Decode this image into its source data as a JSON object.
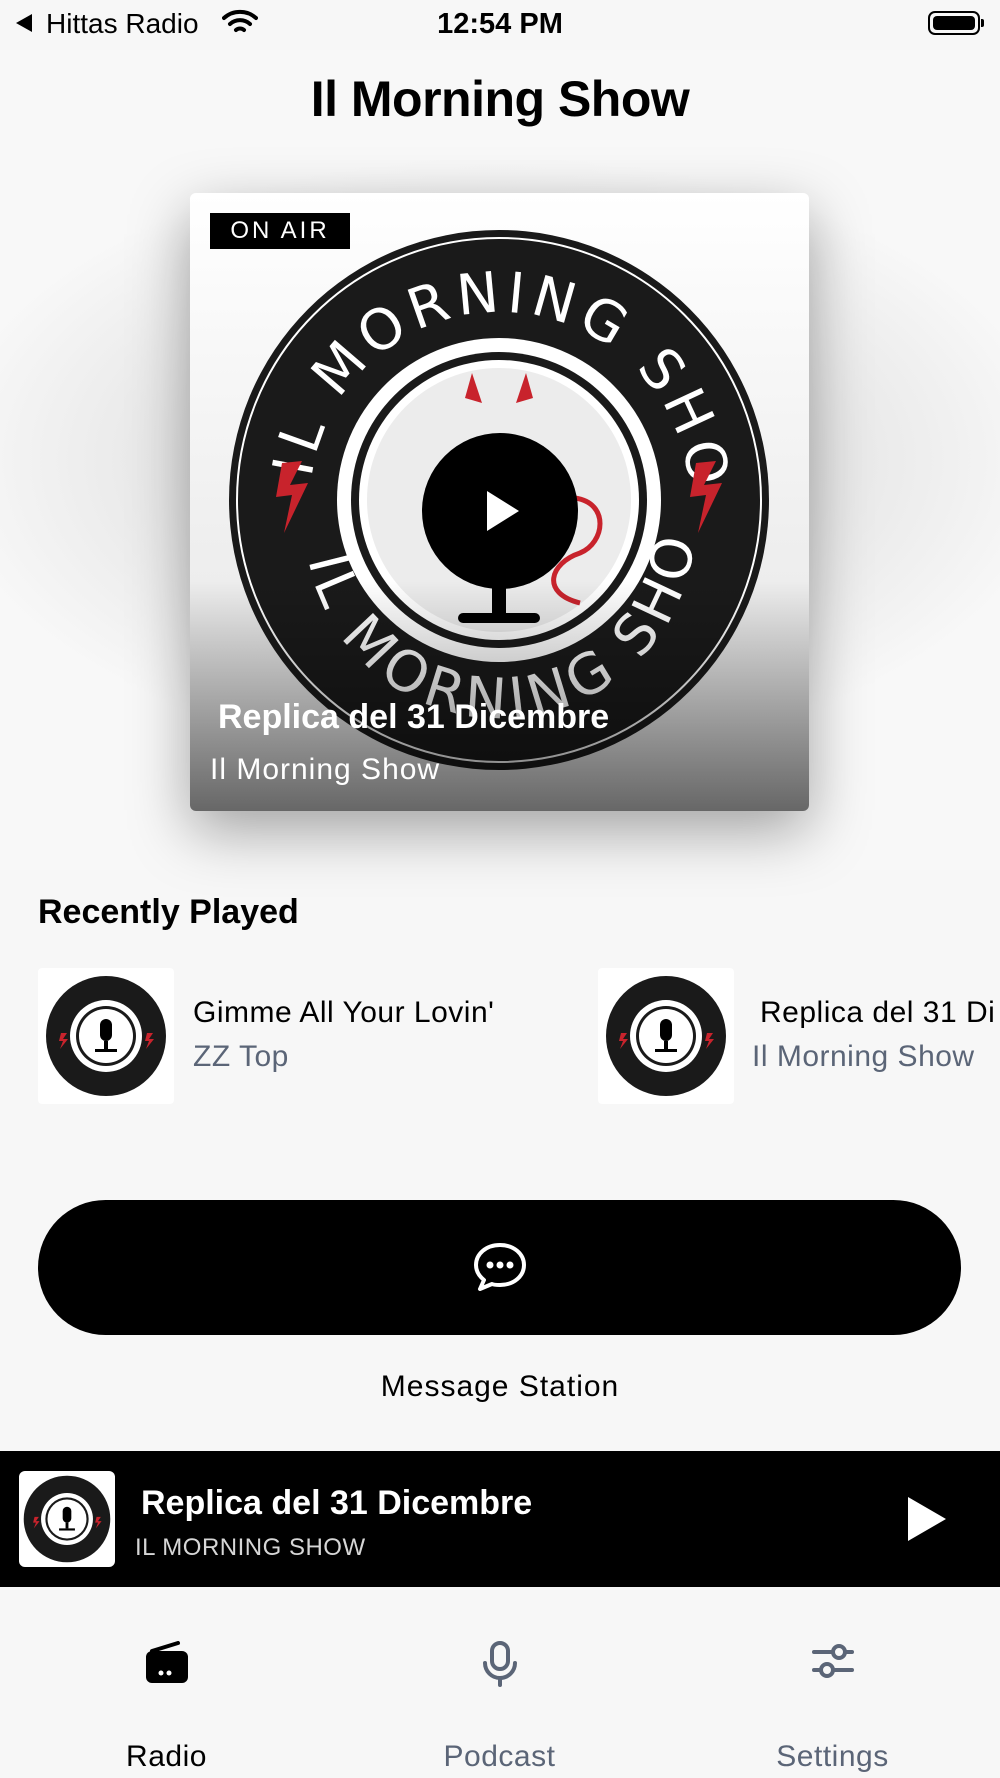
{
  "status_bar": {
    "back_app": "Hittas Radio",
    "time": "12:54 PM"
  },
  "page": {
    "title": "Il Morning Show"
  },
  "now_playing_card": {
    "badge": "ON AIR",
    "title": "Replica del 31 Dicembre",
    "subtitle": "Il Morning Show",
    "artwork": "il-morning-show-logo"
  },
  "recently_played": {
    "heading": "Recently Played",
    "items": [
      {
        "title": "Gimme All Your Lovin'",
        "artist": "ZZ Top"
      },
      {
        "title": "Replica del 31 Di",
        "artist": "Il Morning Show"
      }
    ]
  },
  "message": {
    "icon": "chat-bubble-icon",
    "label": "Message Station"
  },
  "mini_player": {
    "title": "Replica del 31 Dicembre",
    "subtitle": "IL MORNING SHOW"
  },
  "tabs": [
    {
      "label": "Radio",
      "icon": "radio-icon",
      "active": true
    },
    {
      "label": "Podcast",
      "icon": "microphone-icon",
      "active": false
    },
    {
      "label": "Settings",
      "icon": "sliders-icon",
      "active": false
    }
  ],
  "colors": {
    "accent": "#000000",
    "logo_red": "#c8232c",
    "inactive_text": "#5b6577"
  }
}
